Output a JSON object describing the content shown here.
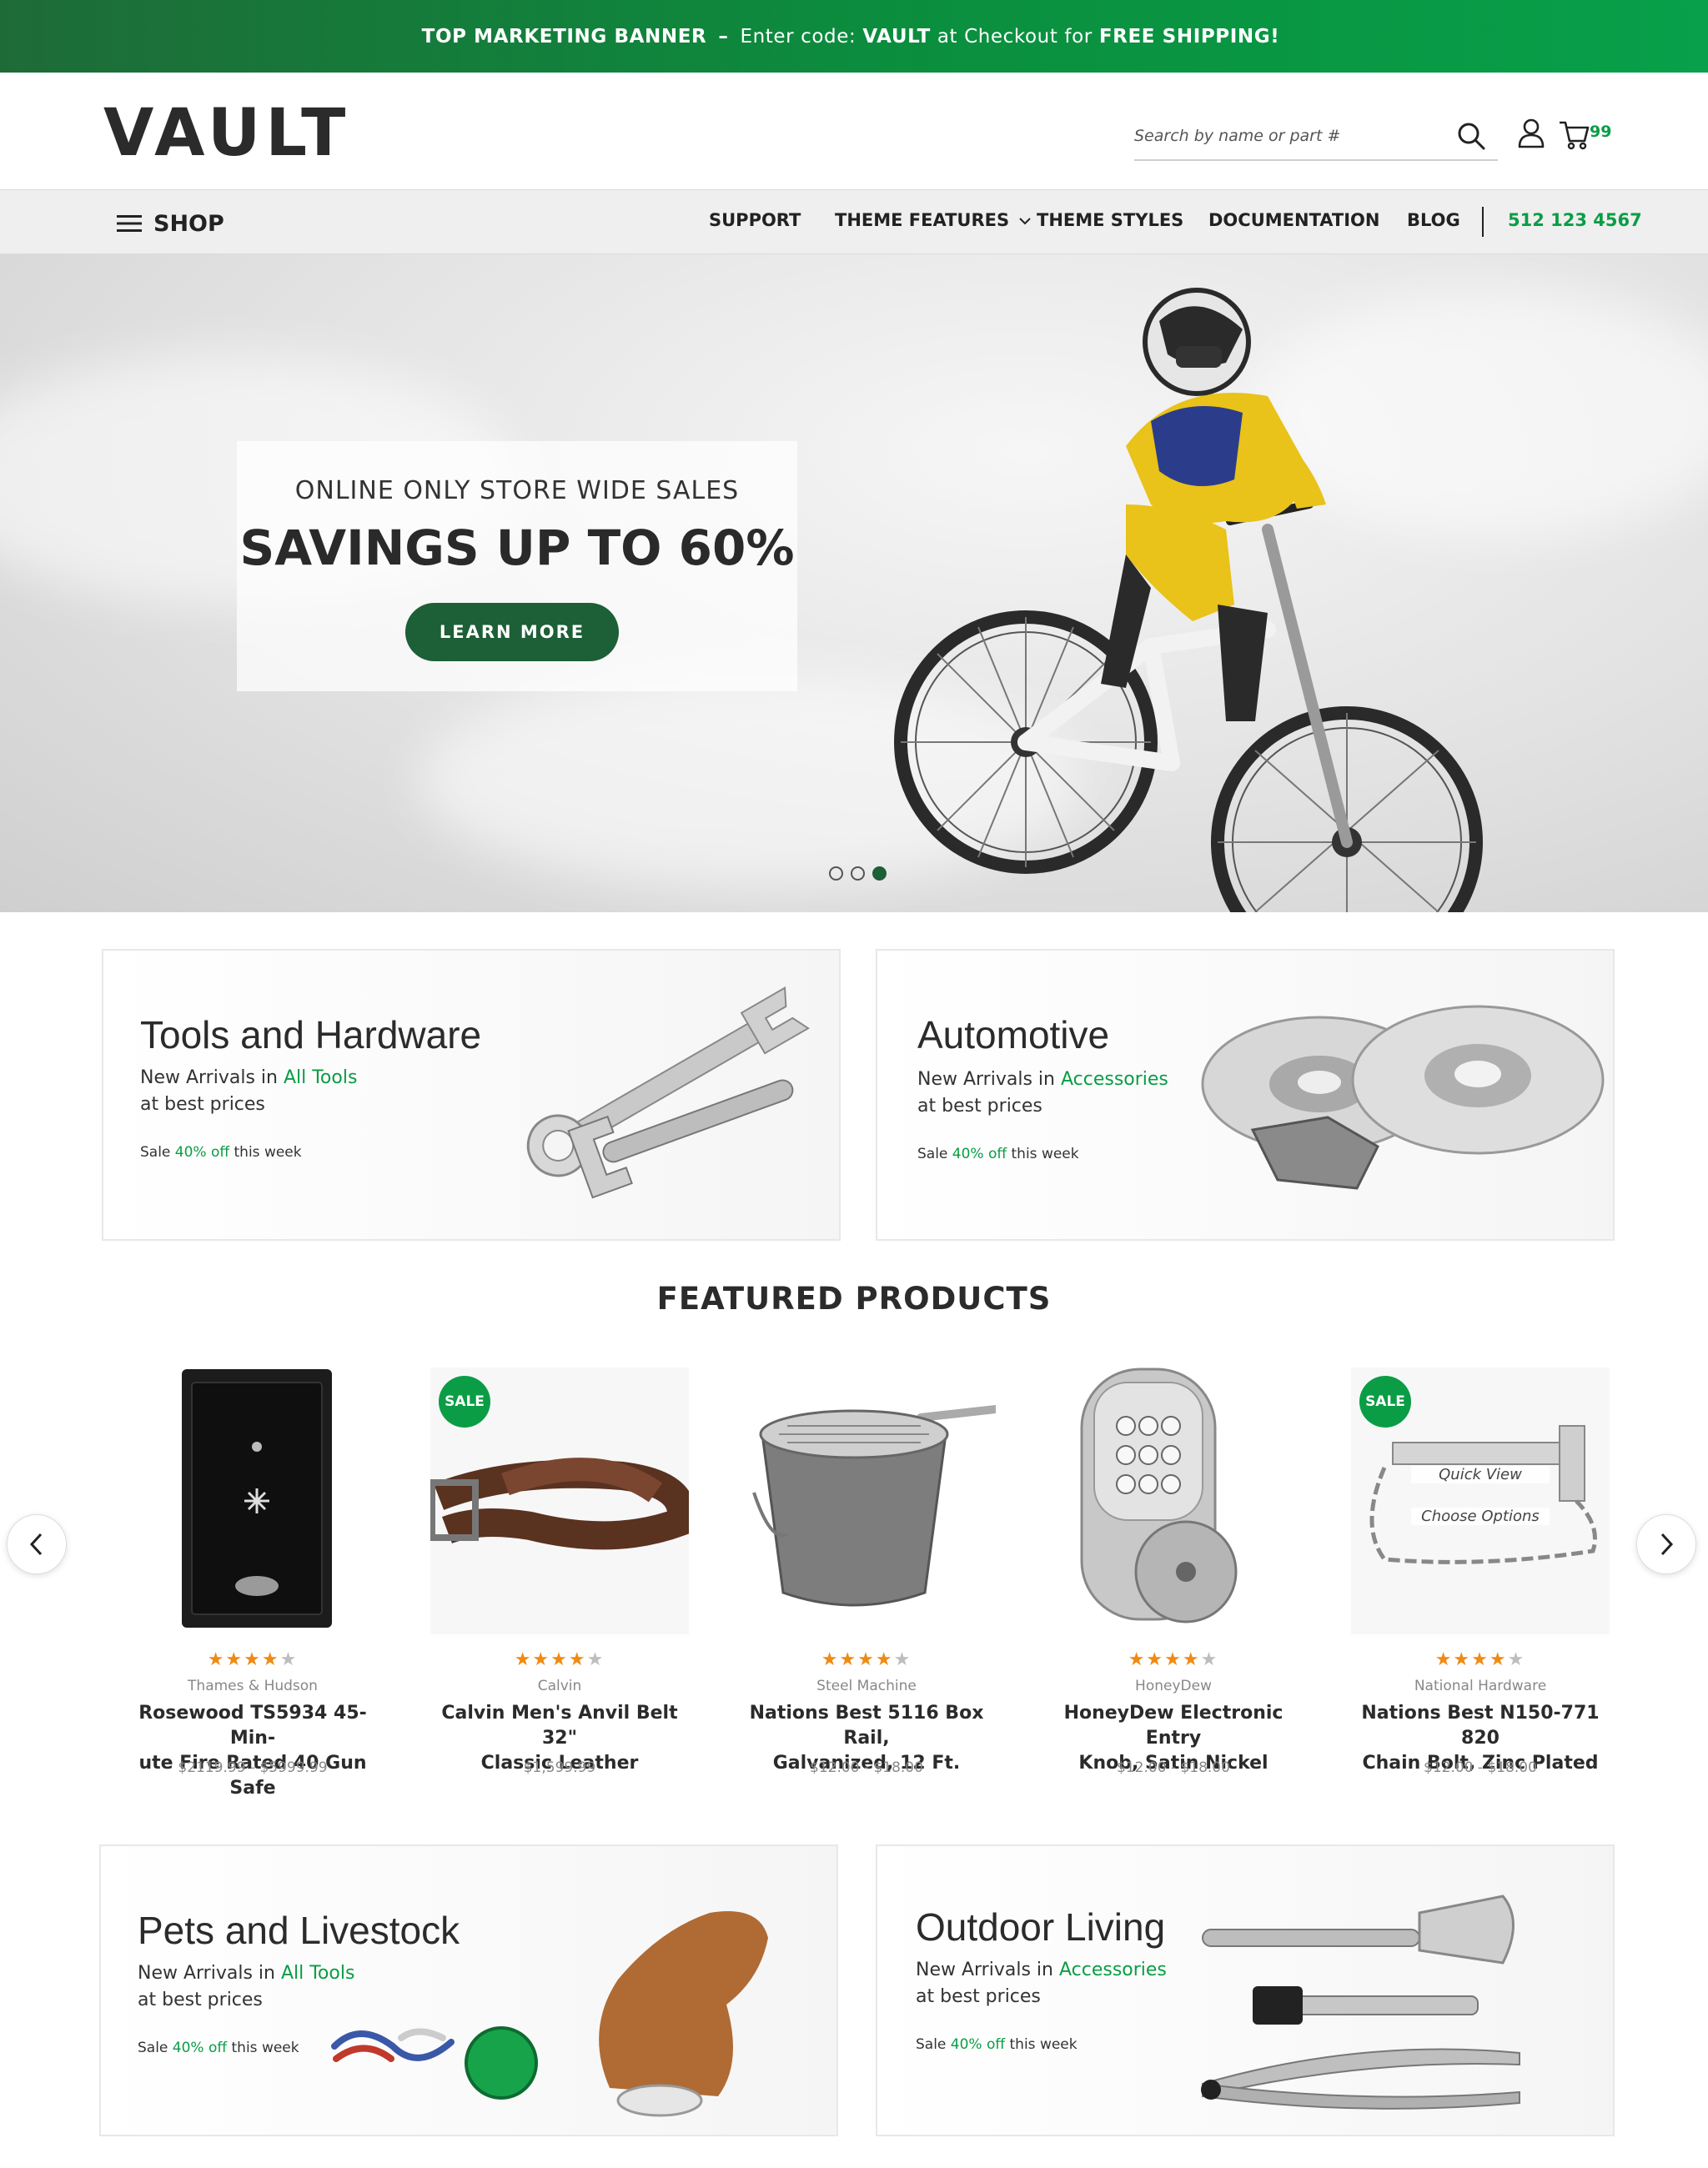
{
  "banner": {
    "lead": "TOP MARKETING BANNER",
    "dash": "–",
    "enter": "Enter code:",
    "code": "VAULT",
    "at": "at Checkout for",
    "offer": "FREE SHIPPING!"
  },
  "header": {
    "logo": "VAULT",
    "search_placeholder": "Search by name or part #",
    "cart_count": "99"
  },
  "nav": {
    "shop": "SHOP",
    "links": [
      "SUPPORT",
      "THEME FEATURES",
      "THEME STYLES",
      "DOCUMENTATION",
      "BLOG"
    ],
    "phone": "512 123 4567"
  },
  "hero": {
    "eyebrow": "ONLINE ONLY STORE WIDE SALES",
    "title": "SAVINGS UP TO 60%",
    "button": "LEARN MORE",
    "slides": 3,
    "active_slide": 3
  },
  "promos": [
    {
      "title": "Tools and Hardware",
      "arrivals": "New Arrivals in",
      "link": "All Tools",
      "prices": "at best prices",
      "sale_pre": "Sale",
      "sale_pct": "40% off",
      "sale_post": "this week"
    },
    {
      "title": "Automotive",
      "arrivals": "New Arrivals in",
      "link": "Accessories",
      "prices": "at best prices",
      "sale_pre": "Sale",
      "sale_pct": "40% off",
      "sale_post": "this week"
    },
    {
      "title": "Pets and Livestock",
      "arrivals": "New Arrivals in",
      "link": "All Tools",
      "prices": "at best prices",
      "sale_pre": "Sale",
      "sale_pct": "40% off",
      "sale_post": "this week"
    },
    {
      "title": "Outdoor Living",
      "arrivals": "New Arrivals in",
      "link": "Accessories",
      "prices": "at best prices",
      "sale_pre": "Sale",
      "sale_pct": "40% off",
      "sale_post": "this week"
    }
  ],
  "featured": {
    "title": "FEATURED PRODUCTS",
    "products": [
      {
        "brand": "Thames & Hudson",
        "name1": "Rosewood TS5934 45-Min-",
        "name2": "ute Fire Rated 40 Gun Safe",
        "price": "$2119.99 - $5999.99",
        "rating": 4,
        "sale": ""
      },
      {
        "brand": "Calvin",
        "name1": "Calvin Men's Anvil Belt 32\"",
        "name2": "Classic Leather",
        "price": "$1,599.99",
        "rating": 4,
        "sale": "SALE"
      },
      {
        "brand": "Steel Machine",
        "name1": "Nations Best 5116 Box Rail,",
        "name2": "Galvanized, 12 Ft.",
        "price": "$12.00 - $18.00",
        "rating": 4,
        "sale": ""
      },
      {
        "brand": "HoneyDew",
        "name1": "HoneyDew Electronic Entry",
        "name2": "Knob, Satin Nickel",
        "price": "$12.00 - $18.00",
        "rating": 4,
        "sale": ""
      },
      {
        "brand": "National Hardware",
        "name1": "Nations Best N150-771 820",
        "name2": "Chain Bolt, Zinc Plated",
        "price": "$12.00 - $18.00",
        "rating": 4,
        "sale": "SALE",
        "quick_view": "Quick View",
        "choose_options": "Choose Options"
      }
    ]
  },
  "colors": {
    "brand_green": "#0a9d45",
    "dark_green": "#1d5f36",
    "star": "#f08a12"
  },
  "icons": [
    "search-icon",
    "user-icon",
    "cart-icon",
    "menu-icon",
    "chevron-down-icon",
    "chevron-left-icon",
    "chevron-right-icon"
  ]
}
